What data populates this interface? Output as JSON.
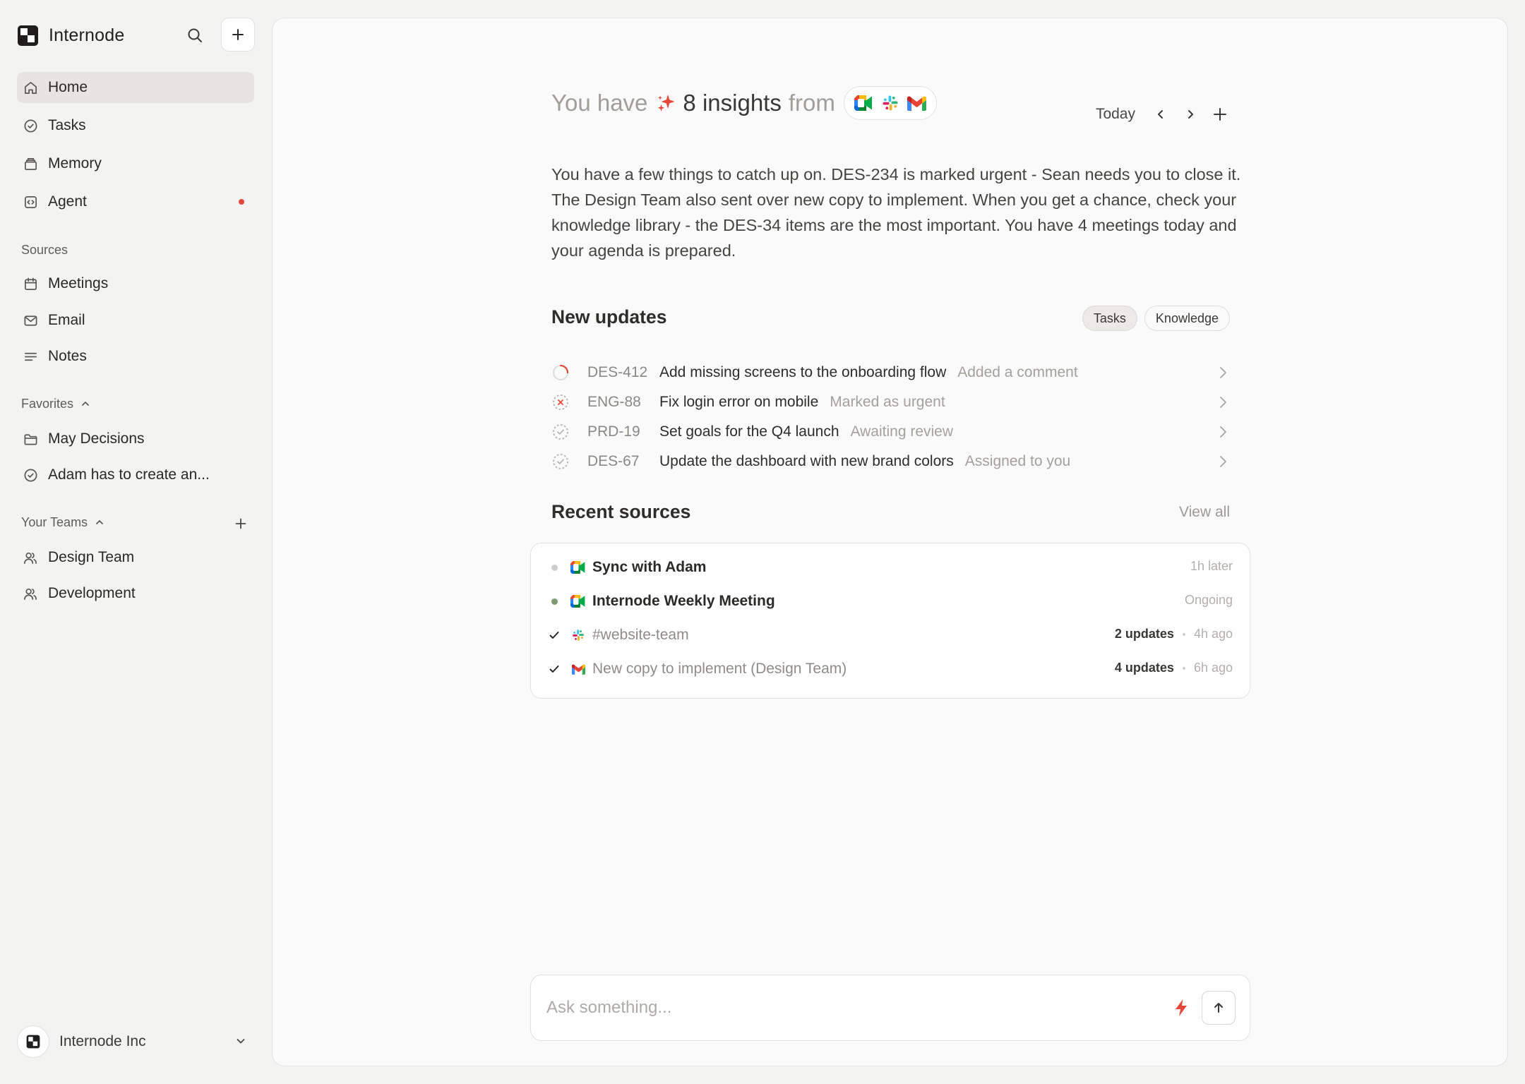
{
  "app": {
    "name": "Internode"
  },
  "sidebar": {
    "nav": [
      {
        "label": "Home",
        "icon": "home-icon",
        "active": true
      },
      {
        "label": "Tasks",
        "icon": "check-circle-icon"
      },
      {
        "label": "Memory",
        "icon": "archive-icon"
      },
      {
        "label": "Agent",
        "icon": "code-box-icon",
        "notification": true
      }
    ],
    "sources_label": "Sources",
    "sources": [
      {
        "label": "Meetings",
        "icon": "calendar-icon"
      },
      {
        "label": "Email",
        "icon": "mail-icon"
      },
      {
        "label": "Notes",
        "icon": "notes-icon"
      }
    ],
    "favorites_label": "Favorites",
    "favorites": [
      {
        "label": "May Decisions",
        "icon": "folder-icon"
      },
      {
        "label": "Adam has to create an...",
        "icon": "check-circle-icon"
      }
    ],
    "teams_label": "Your Teams",
    "teams": [
      {
        "label": "Design Team",
        "icon": "users-icon"
      },
      {
        "label": "Development",
        "icon": "users-icon"
      }
    ],
    "workspace": {
      "name": "Internode Inc"
    }
  },
  "header": {
    "prefix": "You have",
    "insights": "8 insights",
    "suffix": "from",
    "source_icons": [
      "google-meet-icon",
      "slack-icon",
      "gmail-icon"
    ],
    "date_label": "Today"
  },
  "summary": "You have a few things to catch up on. DES-234 is marked urgent - Sean needs you to close it. The Design Team also sent over new copy to implement. When you get a chance, check your knowledge library - the DES-34 items are the most important. You have 4 meetings today and your agenda is prepared.",
  "updates": {
    "title": "New updates",
    "chips": [
      {
        "label": "Tasks",
        "active": true
      },
      {
        "label": "Knowledge",
        "active": false
      }
    ],
    "items": [
      {
        "id": "DES-412",
        "title": "Add missing screens to the onboarding flow",
        "action": "Added a comment",
        "status": "in-progress"
      },
      {
        "id": "ENG-88",
        "title": "Fix login error on mobile",
        "action": "Marked as urgent",
        "status": "urgent"
      },
      {
        "id": "PRD-19",
        "title": "Set goals for the Q4 launch",
        "action": "Awaiting review",
        "status": "todo"
      },
      {
        "id": "DES-67",
        "title": "Update the dashboard with new brand colors",
        "action": "Assigned to you",
        "status": "todo"
      }
    ]
  },
  "recent_sources": {
    "title": "Recent sources",
    "view_all": "View all",
    "items": [
      {
        "title": "Sync with Adam",
        "app": "google-meet-icon",
        "lead": "dot",
        "dot_color": "#cfcdc9",
        "bold": true,
        "count": "",
        "time": "1h later"
      },
      {
        "title": "Internode Weekly Meeting",
        "app": "google-meet-icon",
        "lead": "dot",
        "dot_color": "#7f9a6e",
        "bold": true,
        "count": "",
        "time": "Ongoing"
      },
      {
        "title": "#website-team",
        "app": "slack-icon",
        "lead": "check",
        "bold": false,
        "count": "2 updates",
        "time": "4h ago"
      },
      {
        "title": "New copy to implement (Design Team)",
        "app": "gmail-icon",
        "lead": "check",
        "bold": false,
        "count": "4 updates",
        "time": "6h ago"
      }
    ]
  },
  "ask": {
    "placeholder": "Ask something..."
  },
  "colors": {
    "accent": "#e5483b",
    "background": "#f3f3f2",
    "panel": "#fafafa"
  }
}
